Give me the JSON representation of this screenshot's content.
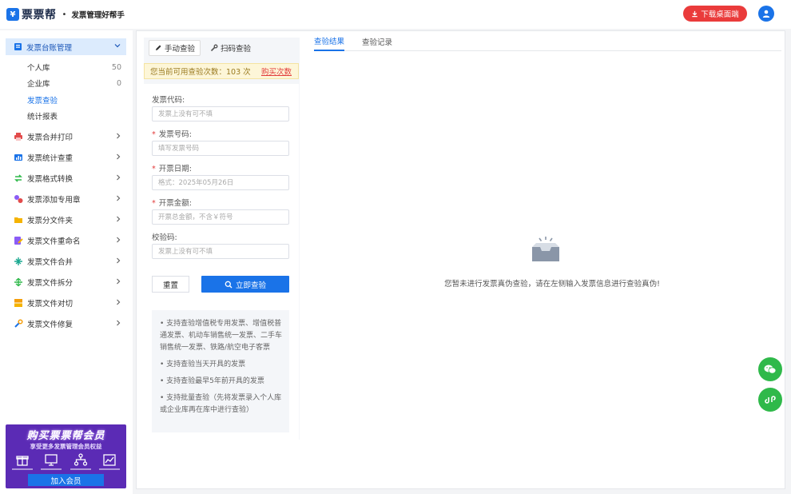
{
  "header": {
    "logo_mark": "¥",
    "logo_text": "票票帮",
    "dot": "•",
    "slogan": "发票管理好帮手",
    "download_label": "下载桌面端"
  },
  "sidebar": {
    "head": "发票台账管理",
    "sub_items": [
      {
        "label": "个人库",
        "count": "50"
      },
      {
        "label": "企业库",
        "count": "0"
      },
      {
        "label": "发票查验",
        "count": ""
      },
      {
        "label": "统计报表",
        "count": ""
      }
    ],
    "items": [
      {
        "label": "发票合并打印",
        "icon": "printer-icon",
        "color": "#e24b4b"
      },
      {
        "label": "发票统计查重",
        "icon": "stats-icon",
        "color": "#1a73e8"
      },
      {
        "label": "发票格式转换",
        "icon": "convert-icon",
        "color": "#2fb94a"
      },
      {
        "label": "发票添加专用章",
        "icon": "stamp-icon",
        "color": "#8b5cf6"
      },
      {
        "label": "发票分文件夹",
        "icon": "folder-icon",
        "color": "#f5b301"
      },
      {
        "label": "发票文件重命名",
        "icon": "rename-icon",
        "color": "#8b5cf6"
      },
      {
        "label": "发票文件合并",
        "icon": "merge-icon",
        "color": "#1aa890"
      },
      {
        "label": "发票文件拆分",
        "icon": "split-icon",
        "color": "#2fb94a"
      },
      {
        "label": "发票文件对切",
        "icon": "cut-icon",
        "color": "#f59e0b"
      },
      {
        "label": "发票文件修复",
        "icon": "repair-icon",
        "color": "#1a73e8"
      }
    ],
    "promo": {
      "title": "购买票票帮会员",
      "subtitle": "享受更多发票管理会员权益",
      "button": "加入会员"
    }
  },
  "check": {
    "tabs": [
      {
        "label": "手动查验",
        "icon": "pen-icon"
      },
      {
        "label": "扫码查验",
        "icon": "wrench-icon"
      }
    ],
    "quota_text": "您当前可用查验次数：103 次",
    "quota_link": "购买次数",
    "fields": [
      {
        "label": "发票代码:",
        "required": false,
        "placeholder": "发票上没有可不填"
      },
      {
        "label": "发票号码:",
        "required": true,
        "placeholder": "填写发票号码"
      },
      {
        "label": "开票日期:",
        "required": true,
        "placeholder": "格式：2025年05月26日"
      },
      {
        "label": "开票金额:",
        "required": true,
        "placeholder": "开票总金额，不含￥符号"
      },
      {
        "label": "校验码:",
        "required": false,
        "placeholder": "发票上没有可不填"
      }
    ],
    "reset_label": "重置",
    "submit_label": "立即查验",
    "notes": [
      "• 支持查验增值税专用发票、增值税普通发票、机动车销售统一发票、二手车销售统一发票、铁路/航空电子客票",
      "• 支持查验当天开具的发票",
      "• 支持查验最早5年前开具的发票",
      "• 支持批量查验（先将发票录入个人库或企业库再在库中进行查验）"
    ]
  },
  "result": {
    "tabs": [
      "查验结果",
      "查验记录"
    ],
    "empty_text": "您暂未进行发票真伪查验，请在左侧输入发票信息进行查验真伪!"
  },
  "colors": {
    "accent": "#1a73e8",
    "danger": "#ea3b3b",
    "wechat": "#2fb94a"
  }
}
